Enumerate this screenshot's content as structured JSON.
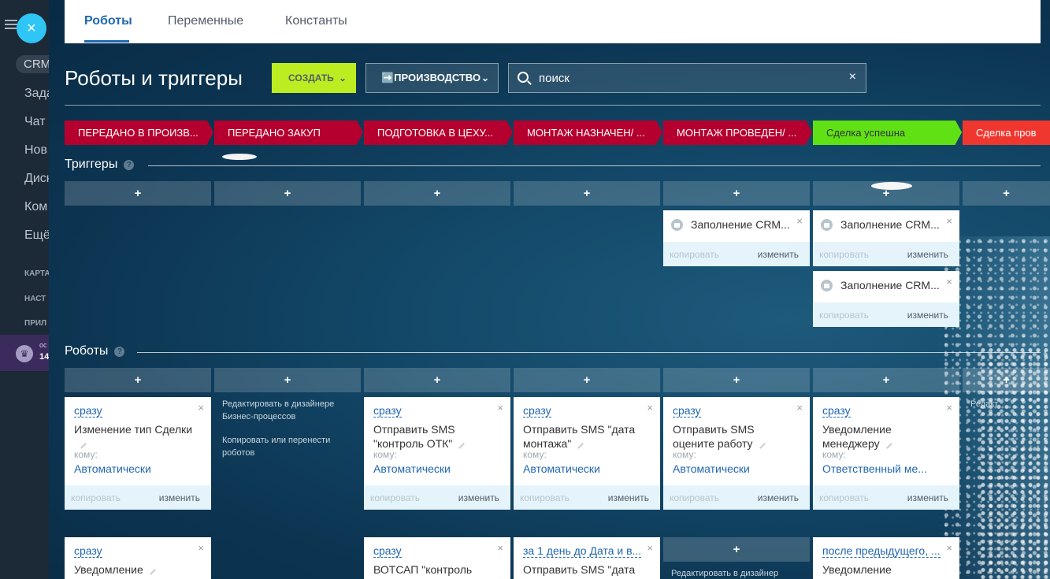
{
  "sidebar": {
    "close_icon": "×",
    "crm": "CRM",
    "items": [
      "Зада",
      "Чат",
      "Нов",
      "Диск",
      "Ком",
      "Ещё"
    ],
    "sections": [
      "КАРТА",
      "НАСТ",
      "ПРИЛ"
    ],
    "promo": {
      "line1": "ос",
      "line2": "14"
    }
  },
  "tabs": [
    {
      "label": "Роботы",
      "active": true
    },
    {
      "label": "Переменные"
    },
    {
      "label": "Константы"
    }
  ],
  "header": {
    "title": "Роботы и триггеры",
    "create_label": "СОЗДАТЬ",
    "pipeline_label": "➡️ПРОИЗВОДСТВО",
    "search_placeholder": "поиск"
  },
  "stages": [
    {
      "label": "ПЕРЕДАНО В ПРОИЗВ...",
      "color": "#b5002f"
    },
    {
      "label": "ПЕРЕДАНО ЗАКУП",
      "color": "#b5002f"
    },
    {
      "label": "ПОДГОТОВКА В ЦЕХУ...",
      "color": "#b5002f"
    },
    {
      "label": "МОНТАЖ НАЗНАЧЕН/ ...",
      "color": "#b5002f"
    },
    {
      "label": "МОНТАЖ ПРОВЕДЕН/ ...",
      "color": "#b5002f"
    },
    {
      "label": "Сделка успешна",
      "color": "#5fe114"
    },
    {
      "label": "Сделка пров",
      "color": "#f0372f"
    }
  ],
  "sections": {
    "triggers": "Триггеры",
    "robots": "Роботы",
    "help": "?"
  },
  "common": {
    "add": "+",
    "close": "×",
    "copy": "копировать",
    "edit": "изменить",
    "to": "кому:"
  },
  "triggers": [
    {
      "name": "Заполнение CRM..."
    },
    {
      "name": "Заполнение CRM..."
    },
    {
      "name": "Заполнение CRM..."
    }
  ],
  "robots": [
    {
      "when": "сразу",
      "title": "Изменение тип Сделки",
      "to": "",
      "value": "Автоматически"
    },
    {
      "when": "сразу",
      "title": "Отправить SMS \"контроль ОТК\"",
      "value": "Автоматически"
    },
    {
      "when": "сразу",
      "title": "Отправить SMS \"дата монтажа\"",
      "value": "Автоматически"
    },
    {
      "when": "сразу",
      "title": "Отправить SMS оцените работу",
      "value": "Автоматически"
    },
    {
      "when": "сразу",
      "title": "Уведомление менеджеру",
      "value": "Ответственный ме..."
    }
  ],
  "robots_row2": [
    {
      "when": "сразу",
      "title": "Уведомление"
    },
    {
      "when": "сразу",
      "title": "ВОТСАП \"контроль"
    },
    {
      "when": "за 1 день до Дата и в...",
      "title": "Отправить SMS \"дата"
    },
    {
      "when": "после предыдущего, ...",
      "title": "Уведомление"
    }
  ],
  "designer_note": {
    "line1": "Редактировать в дизайнере Бизнес-процессов",
    "line2": "Копировать или перенести роботов",
    "short": "Редактировать в дизайнер"
  },
  "edge_note": "Редакт"
}
